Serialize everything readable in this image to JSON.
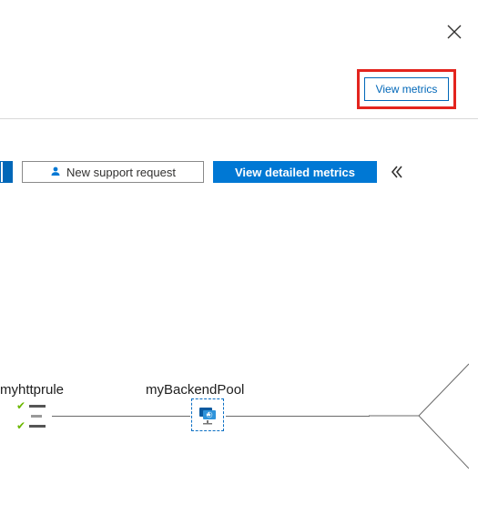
{
  "header": {
    "view_metrics_label": "View metrics"
  },
  "toolbar": {
    "support_request_label": "New support request",
    "detailed_metrics_label": "View detailed metrics"
  },
  "diagram": {
    "rule_label": "myhttprule",
    "pool_label": "myBackendPool"
  }
}
